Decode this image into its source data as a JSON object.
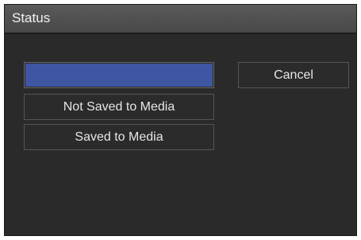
{
  "dialog": {
    "title": "Status"
  },
  "buttons": {
    "selected_item_label": "",
    "not_saved_label": "Not Saved to Media",
    "saved_label": "Saved to Media",
    "cancel_label": "Cancel"
  },
  "colors": {
    "selection": "#3f56a3",
    "background": "#2a2a2a",
    "titlebar": "#505050"
  }
}
